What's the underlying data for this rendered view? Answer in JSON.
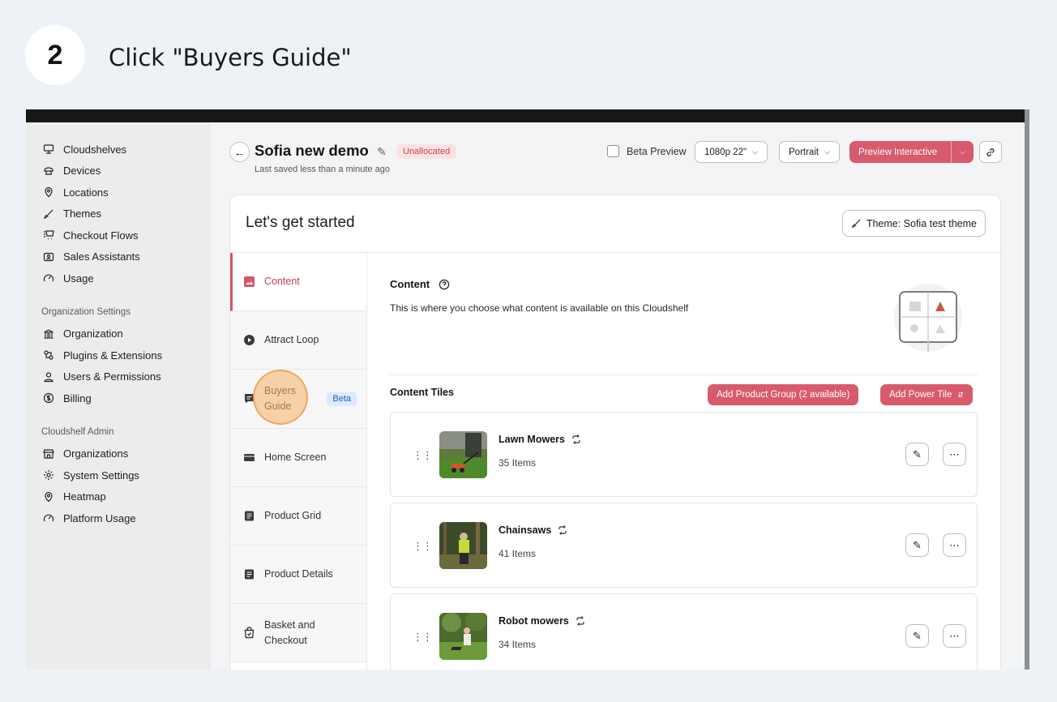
{
  "step": {
    "number": "2",
    "instruction": "Click \"Buyers Guide\""
  },
  "sidebar": {
    "items": [
      {
        "label": "Cloudshelves",
        "icon": "cloudshelves-icon"
      },
      {
        "label": "Devices",
        "icon": "devices-icon"
      },
      {
        "label": "Locations",
        "icon": "location-pin-icon"
      },
      {
        "label": "Themes",
        "icon": "brush-icon"
      },
      {
        "label": "Checkout Flows",
        "icon": "cart-icon"
      },
      {
        "label": "Sales Assistants",
        "icon": "id-card-icon"
      },
      {
        "label": "Usage",
        "icon": "gauge-icon"
      }
    ],
    "org_heading": "Organization Settings",
    "org_items": [
      {
        "label": "Organization",
        "icon": "bank-icon"
      },
      {
        "label": "Plugins & Extensions",
        "icon": "plugins-icon"
      },
      {
        "label": "Users & Permissions",
        "icon": "user-icon"
      },
      {
        "label": "Billing",
        "icon": "dollar-icon"
      }
    ],
    "admin_heading": "Cloudshelf Admin",
    "admin_items": [
      {
        "label": "Organizations",
        "icon": "store-icon"
      },
      {
        "label": "System Settings",
        "icon": "gear-icon"
      },
      {
        "label": "Heatmap",
        "icon": "location-pin-icon"
      },
      {
        "label": "Platform Usage",
        "icon": "gauge-icon"
      }
    ]
  },
  "header": {
    "title": "Sofia new demo",
    "status_badge": "Unallocated",
    "saved_text": "Last saved less than a minute ago",
    "beta_preview_label": "Beta Preview",
    "resolution": "1080p 22\"",
    "orientation": "Portrait",
    "preview_button": "Preview Interactive"
  },
  "card": {
    "title": "Let's get started",
    "theme_button": "Theme: Sofia test theme",
    "tabs": [
      {
        "label": "Content"
      },
      {
        "label": "Attract Loop"
      },
      {
        "label": "Buyers Guide",
        "badge": "Beta"
      },
      {
        "label": "Home Screen"
      },
      {
        "label": "Product Grid"
      },
      {
        "label": "Product Details"
      },
      {
        "label": "Basket and Checkout"
      }
    ],
    "content": {
      "title": "Content",
      "description": "This is where you choose what content is available on this Cloudshelf",
      "tiles_title": "Content Tiles",
      "add_group_button": "Add Product Group (2 available)",
      "add_power_button": "Add Power Tile",
      "tiles": [
        {
          "name": "Lawn Mowers",
          "count": "35 Items"
        },
        {
          "name": "Chainsaws",
          "count": "41 Items"
        },
        {
          "name": "Robot mowers",
          "count": "34 Items"
        }
      ]
    }
  },
  "colors": {
    "accent": "#d85a6d",
    "accent_text": "#c23f53",
    "badge_bg": "#fce3e3",
    "beta_bg": "#dceafd",
    "highlight": "#f4b067"
  }
}
